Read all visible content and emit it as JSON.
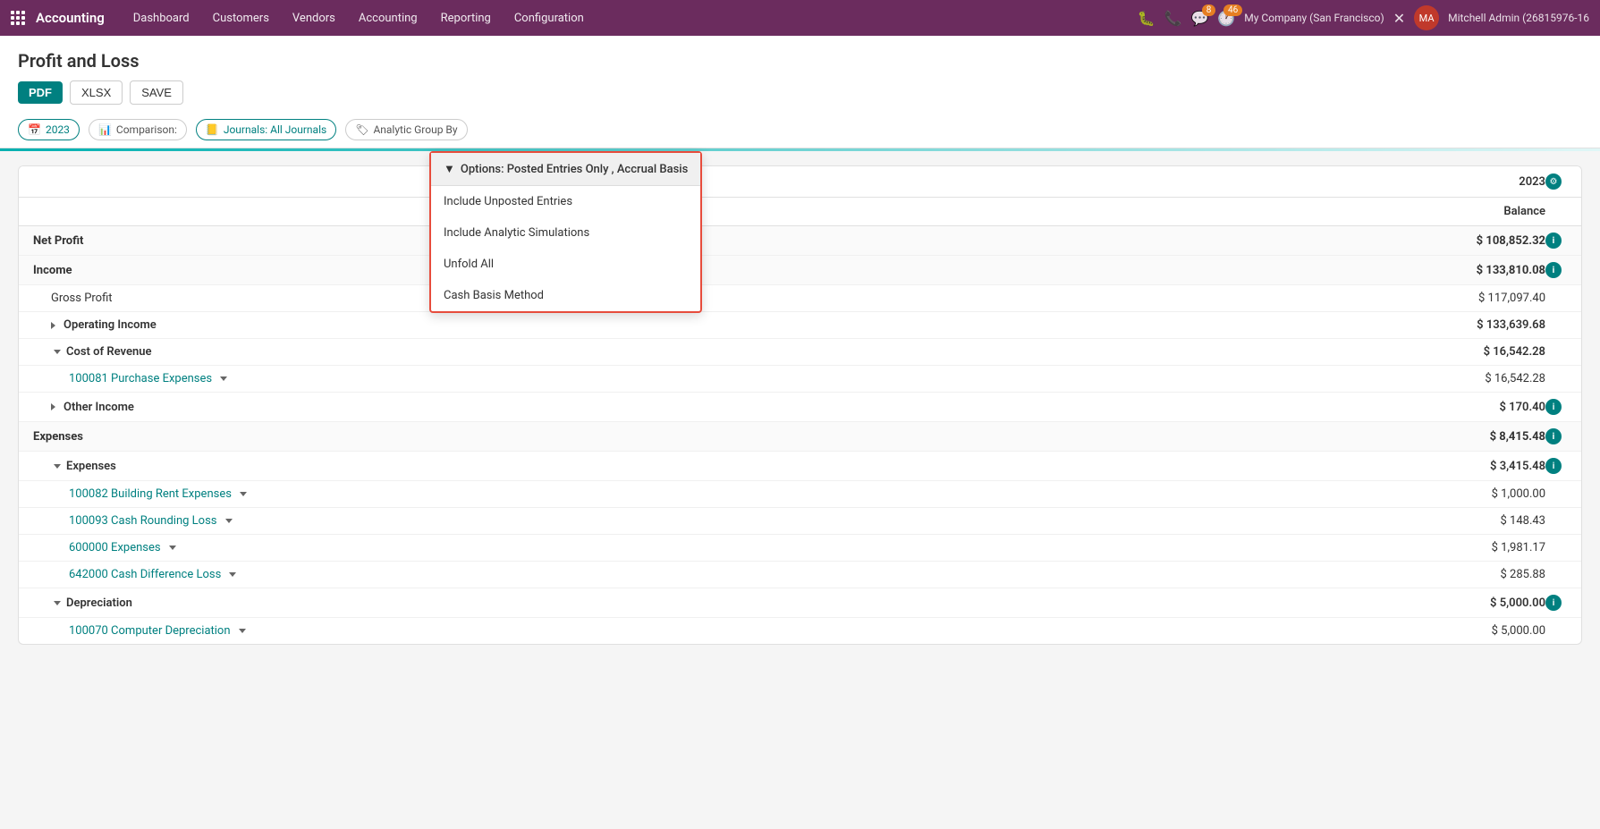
{
  "app": {
    "name": "Accounting",
    "nav_items": [
      "Dashboard",
      "Customers",
      "Vendors",
      "Accounting",
      "Reporting",
      "Configuration"
    ],
    "company": "My Company (San Francisco)",
    "user": "Mitchell Admin (26815976-16",
    "notification_count": "8",
    "activity_count": "46"
  },
  "page": {
    "title": "Profit and Loss",
    "buttons": {
      "pdf": "PDF",
      "xlsx": "XLSX",
      "save": "SAVE"
    }
  },
  "filters": {
    "date": "2023",
    "comparison": "Comparison:",
    "journals": "Journals: All Journals",
    "analytic": "Analytic Group By",
    "options_label": "Options: Posted Entries Only , Accrual Basis"
  },
  "dropdown": {
    "title": "Options: Posted Entries Only , Accrual Basis",
    "items": [
      "Include Unposted Entries",
      "Include Analytic Simulations",
      "Unfold All",
      "Cash Basis Method"
    ]
  },
  "report": {
    "year_col": "2023",
    "balance_col": "Balance",
    "rows": [
      {
        "label": "Net Profit",
        "value": "$ 108,852.32",
        "indent": 0,
        "type": "section-header",
        "has_info": true,
        "expanded": false
      },
      {
        "label": "Income",
        "value": "$ 133,810.08",
        "indent": 0,
        "type": "section-header",
        "has_info": true,
        "expanded": false
      },
      {
        "label": "Gross Profit",
        "value": "$ 117,097.40",
        "indent": 1,
        "type": "normal",
        "has_info": false,
        "expanded": false
      },
      {
        "label": "Operating Income",
        "value": "$ 133,639.68",
        "indent": 1,
        "type": "sub-section",
        "has_info": false,
        "expanded": false,
        "arrow": "right"
      },
      {
        "label": "Cost of Revenue",
        "value": "$ 16,542.28",
        "indent": 1,
        "type": "sub-section",
        "has_info": false,
        "expanded": true,
        "arrow": "down"
      },
      {
        "label": "100081 Purchase Expenses",
        "value": "$ 16,542.28",
        "indent": 2,
        "type": "link",
        "has_info": false,
        "expanded": false,
        "chevron": true
      },
      {
        "label": "Other Income",
        "value": "$ 170.40",
        "indent": 1,
        "type": "sub-section",
        "has_info": true,
        "expanded": false,
        "arrow": "right"
      },
      {
        "label": "Expenses",
        "value": "$ 8,415.48",
        "indent": 0,
        "type": "section-header",
        "has_info": true,
        "expanded": false
      },
      {
        "label": "Expenses",
        "value": "$ 3,415.48",
        "indent": 1,
        "type": "sub-section",
        "has_info": true,
        "expanded": true,
        "arrow": "down"
      },
      {
        "label": "100082 Building Rent Expenses",
        "value": "$ 1,000.00",
        "indent": 2,
        "type": "link",
        "has_info": false,
        "expanded": false,
        "chevron": true
      },
      {
        "label": "100093 Cash Rounding Loss",
        "value": "$ 148.43",
        "indent": 2,
        "type": "link",
        "has_info": false,
        "expanded": false,
        "chevron": true
      },
      {
        "label": "600000 Expenses",
        "value": "$ 1,981.17",
        "indent": 2,
        "type": "link",
        "has_info": false,
        "expanded": false,
        "chevron": true
      },
      {
        "label": "642000 Cash Difference Loss",
        "value": "$ 285.88",
        "indent": 2,
        "type": "link",
        "has_info": false,
        "expanded": false,
        "chevron": true
      },
      {
        "label": "Depreciation",
        "value": "$ 5,000.00",
        "indent": 1,
        "type": "sub-section",
        "has_info": true,
        "expanded": true,
        "arrow": "down"
      },
      {
        "label": "100070 Computer Depreciation",
        "value": "$ 5,000.00",
        "indent": 2,
        "type": "link",
        "has_info": false,
        "expanded": false,
        "chevron": true
      }
    ]
  }
}
